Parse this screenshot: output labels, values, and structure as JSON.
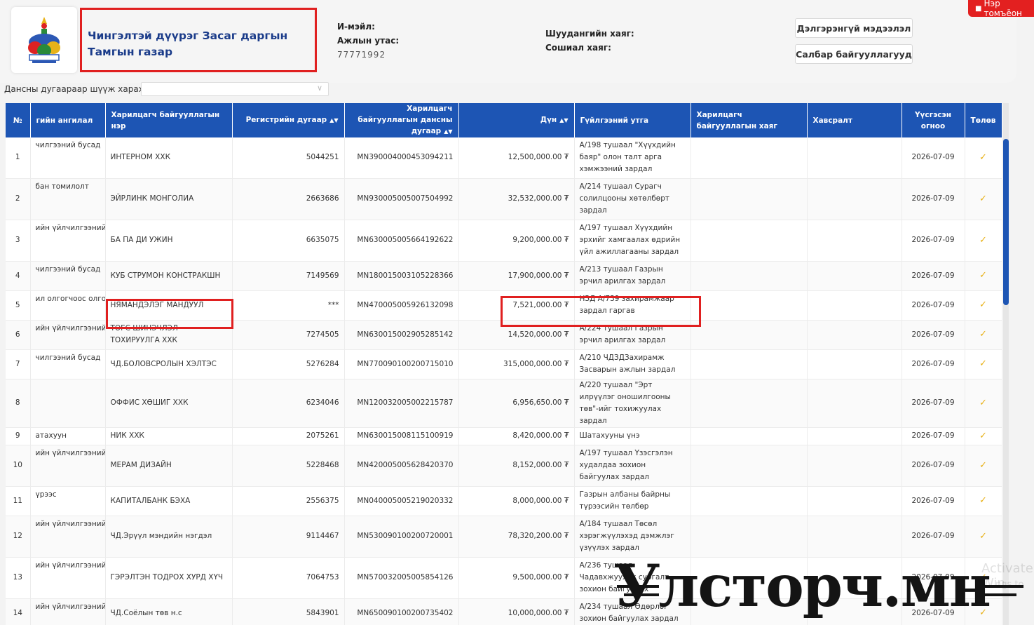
{
  "header": {
    "org_name": "Чингэлтэй дүүрэг Засаг даргын Тамгын газар",
    "email_label": "И-мэйл:",
    "phone_label": "Ажлын утас:",
    "phone_value": "77771992",
    "shop_label": "Шуудангийн хаяг:",
    "social_label": "Сошиал хаяг:",
    "details_button": "Дэлгэрэнгүй мэдээлэл",
    "branches_button": "Салбар байгууллагууд",
    "ribbon": "Нэр томъёон"
  },
  "filter": {
    "label": "Дансны дугаараар шүүж харах:"
  },
  "table": {
    "columns": [
      "№",
      "гийн ангилал",
      "Харилцагч байгууллагын нэр",
      "Регистрийн дугаар",
      "Харилцагч байгууллагын дансны дугаар",
      "Дүн",
      "Гүйлгээний утга",
      "Харилцагч байгууллагын хаяг",
      "Хавсралт",
      "Үүсгэсэн огноо",
      "Төлөв"
    ],
    "rows": [
      {
        "no": "1",
        "cat": "чилгээний бусад",
        "name": "ИНТЕРНОМ ХХК",
        "reg": "5044251",
        "acct": "MN390004000453094211",
        "amount": "12,500,000.00 ₮",
        "desc": "А/198 тушаал \"Хүүхдийн баяр\" олон талт арга хэмжээний зардал",
        "date": "2026-07-09"
      },
      {
        "no": "2",
        "cat": "бан томилолт",
        "name": "ЭЙРЛИНК МОНГОЛИА",
        "reg": "2663686",
        "acct": "MN930005005007504992",
        "amount": "32,532,000.00 ₮",
        "desc": "А/214 тушаал Сурагч солилцооны хөтөлбөрт зардал",
        "date": "2026-07-09"
      },
      {
        "no": "3",
        "cat": "ийн үйлчилгээний",
        "name": "БА ПА ДИ УЖИН",
        "reg": "6635075",
        "acct": "MN630005005664192622",
        "amount": "9,200,000.00 ₮",
        "desc": "А/197 тушаал Хүүхдийн эрхийг хамгаалах өдрийн үйл ажиллагааны зардал",
        "date": "2026-07-09"
      },
      {
        "no": "4",
        "cat": "чилгээний бусад",
        "name": "КУБ СТРУМОН КОНСТРАКШН",
        "reg": "7149569",
        "acct": "MN180015003105228366",
        "amount": "17,900,000.00 ₮",
        "desc": "А/213 тушаал Газрын эрчил арилгах зардал",
        "date": "2026-07-09"
      },
      {
        "no": "5",
        "cat": "ил олгогчоос олгох",
        "name": "НЯМАНДЭЛЭГ МАНДУУЛ",
        "reg": "***",
        "acct": "MN470005005926132098",
        "amount": "7,521,000.00 ₮",
        "desc": "НЗД А/739 захирамжаар зардал гаргав",
        "date": "2026-07-09"
      },
      {
        "no": "6",
        "cat": "ийн үйлчилгээний",
        "name": "ТӨГС ШИНЭЧЛЭЛ ТОХИРУУЛГА ХХК",
        "reg": "7274505",
        "acct": "MN630015002905285142",
        "amount": "14,520,000.00 ₮",
        "desc": "А/224 тушаал Газрын эрчил арилгах зардал",
        "date": "2026-07-09"
      },
      {
        "no": "7",
        "cat": "чилгээний бусад",
        "name": "ЧД.БОЛОВСРОЛЫН ХЭЛТЭС",
        "reg": "5276284",
        "acct": "MN770090100200715010",
        "amount": "315,000,000.00 ₮",
        "desc": "А/210 ЧДЗДЗахирамж Засварын ажлын зардал",
        "date": "2026-07-09"
      },
      {
        "no": "8",
        "cat": "",
        "name": "ОФФИС ХӨШИГ ХХК",
        "reg": "6234046",
        "acct": "MN120032005002215787",
        "amount": "6,956,650.00 ₮",
        "desc": "А/220 тушаал \"Эрт илрүүлэг оношилгооны төв\"-ийг тохижуулах зардал",
        "date": "2026-07-09"
      },
      {
        "no": "9",
        "cat": "атахуун",
        "name": "НИК ХХК",
        "reg": "2075261",
        "acct": "MN630015008115100919",
        "amount": "8,420,000.00 ₮",
        "desc": "Шатахууны үнэ",
        "date": "2026-07-09"
      },
      {
        "no": "10",
        "cat": "ийн үйлчилгээний",
        "name": "МЕРАМ ДИЗАЙН",
        "reg": "5228468",
        "acct": "MN420005005628420370",
        "amount": "8,152,000.00 ₮",
        "desc": "А/197 тушаал Үзэсгэлэн худалдаа зохион байгуулах зардал",
        "date": "2026-07-09"
      },
      {
        "no": "11",
        "cat": "үрээс",
        "name": "КАПИТАЛБАНК БЭХА",
        "reg": "2556375",
        "acct": "MN040005005219020332",
        "amount": "8,000,000.00 ₮",
        "desc": "Газрын албаны байрны түрээсийн төлбөр",
        "date": "2026-07-09"
      },
      {
        "no": "12",
        "cat": "ийн үйлчилгээний",
        "name": "ЧД.Эрүүл мэндийн нэгдэл",
        "reg": "9114467",
        "acct": "MN530090100200720001",
        "amount": "78,320,200.00 ₮",
        "desc": "А/184 тушаал Төсөл хэрэгжүүлэхэд дэмжлэг үзүүлэх зардал",
        "date": "2026-07-09"
      },
      {
        "no": "13",
        "cat": "ийн үйлчилгээний",
        "name": "ГЭРЭЛТЭН ТОДРОХ ХУРД ХҮЧ",
        "reg": "7064753",
        "acct": "MN570032005005854126",
        "amount": "9,500,000.00 ₮",
        "desc": "А/236 тушаал Чадавхжуулах сургалт зохион байгуулах",
        "date": "2026-07-09"
      },
      {
        "no": "14",
        "cat": "ийн үйлчилгээний",
        "name": "ЧД.Соёлын төв н.с",
        "reg": "5843901",
        "acct": "MN650090100200735402",
        "amount": "10,000,000.00 ₮",
        "desc": "А/234 тушаал Өдөрлөг зохион байгуулах зардал",
        "date": "2026-07-09"
      }
    ]
  },
  "watermark": {
    "text": "Улсторч.мн",
    "ghost": "Activate Win",
    "ghost2": "ngs to"
  },
  "colors": {
    "header_blue": "#1d55b4",
    "highlight_red": "#e02020",
    "check": "#e8b21a",
    "title_blue": "#1b3c8a"
  }
}
